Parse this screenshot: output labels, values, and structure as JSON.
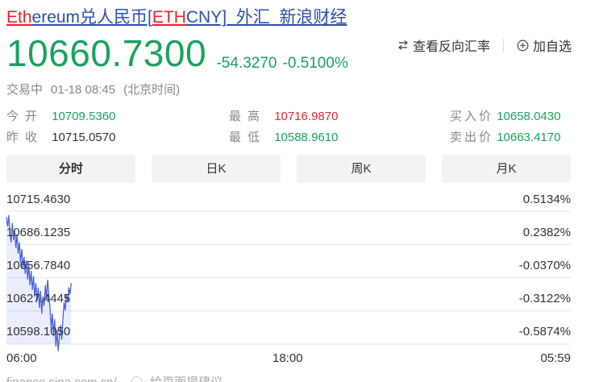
{
  "header": {
    "title_part1": "Eth",
    "title_part2": "ereum兑人民币[",
    "title_part3": "ETH",
    "title_part4": "CNY]_外汇_新浪财经"
  },
  "price": {
    "last": "10660.7300",
    "change": "-54.3270",
    "change_pct": "-0.5100%"
  },
  "actions": {
    "reverse_label": "查看反向汇率",
    "watch_label": "加自选"
  },
  "status": {
    "state": "交易中",
    "time": "01-18 08:45",
    "tz": "(北京时间)"
  },
  "quotes": {
    "open_label": "今开",
    "open_value": "10709.5360",
    "prev_label": "昨收",
    "prev_value": "10715.0570",
    "high_label": "最高",
    "high_value": "10716.9870",
    "low_label": "最低",
    "low_value": "10588.9610",
    "bid_label": "买入价",
    "bid_value": "10658.0430",
    "ask_label": "卖出价",
    "ask_value": "10663.4170"
  },
  "tabs": [
    {
      "label": "分时"
    },
    {
      "label": "日K"
    },
    {
      "label": "周K"
    },
    {
      "label": "月K"
    }
  ],
  "chart_data": {
    "type": "line",
    "x_ticks": [
      "06:00",
      "18:00",
      "05:59"
    ],
    "y_ticks_left": [
      "10715.4630",
      "10686.1235",
      "10656.7840",
      "10627.4445",
      "10598.1050"
    ],
    "y_ticks_right": [
      "0.5134%",
      "0.2382%",
      "-0.0370%",
      "-0.3122%",
      "-0.5874%"
    ],
    "ylim": [
      10598.105,
      10715.463
    ],
    "session_minutes": 1439,
    "series": [
      {
        "minutes": [
          0,
          3,
          6,
          9,
          12,
          15,
          18,
          21,
          24,
          27,
          30,
          33,
          36,
          39,
          42,
          45,
          48,
          51,
          54,
          57,
          60,
          63,
          66,
          69,
          72,
          75,
          78,
          81,
          84,
          87,
          90,
          93,
          96,
          99,
          102,
          105,
          108,
          111,
          114,
          117,
          120,
          123,
          126,
          129,
          132,
          135,
          138,
          141,
          144,
          147,
          150,
          153,
          156,
          159,
          162,
          165
        ],
        "values": [
          10710,
          10702,
          10712,
          10695,
          10688,
          10705,
          10690,
          10698,
          10683,
          10695,
          10678,
          10688,
          10670,
          10682,
          10665,
          10675,
          10660,
          10672,
          10655,
          10668,
          10650,
          10663,
          10646,
          10658,
          10640,
          10652,
          10636,
          10648,
          10630,
          10645,
          10625,
          10640,
          10632,
          10650,
          10638,
          10655,
          10642,
          10630,
          10612,
          10625,
          10605,
          10620,
          10596,
          10610,
          10592,
          10605,
          10615,
          10602,
          10620,
          10635,
          10628,
          10642,
          10635,
          10648,
          10642,
          10652
        ]
      }
    ]
  },
  "footer": {
    "site": "finance.sina.com.cn/",
    "feedback": "给页面提建议"
  }
}
